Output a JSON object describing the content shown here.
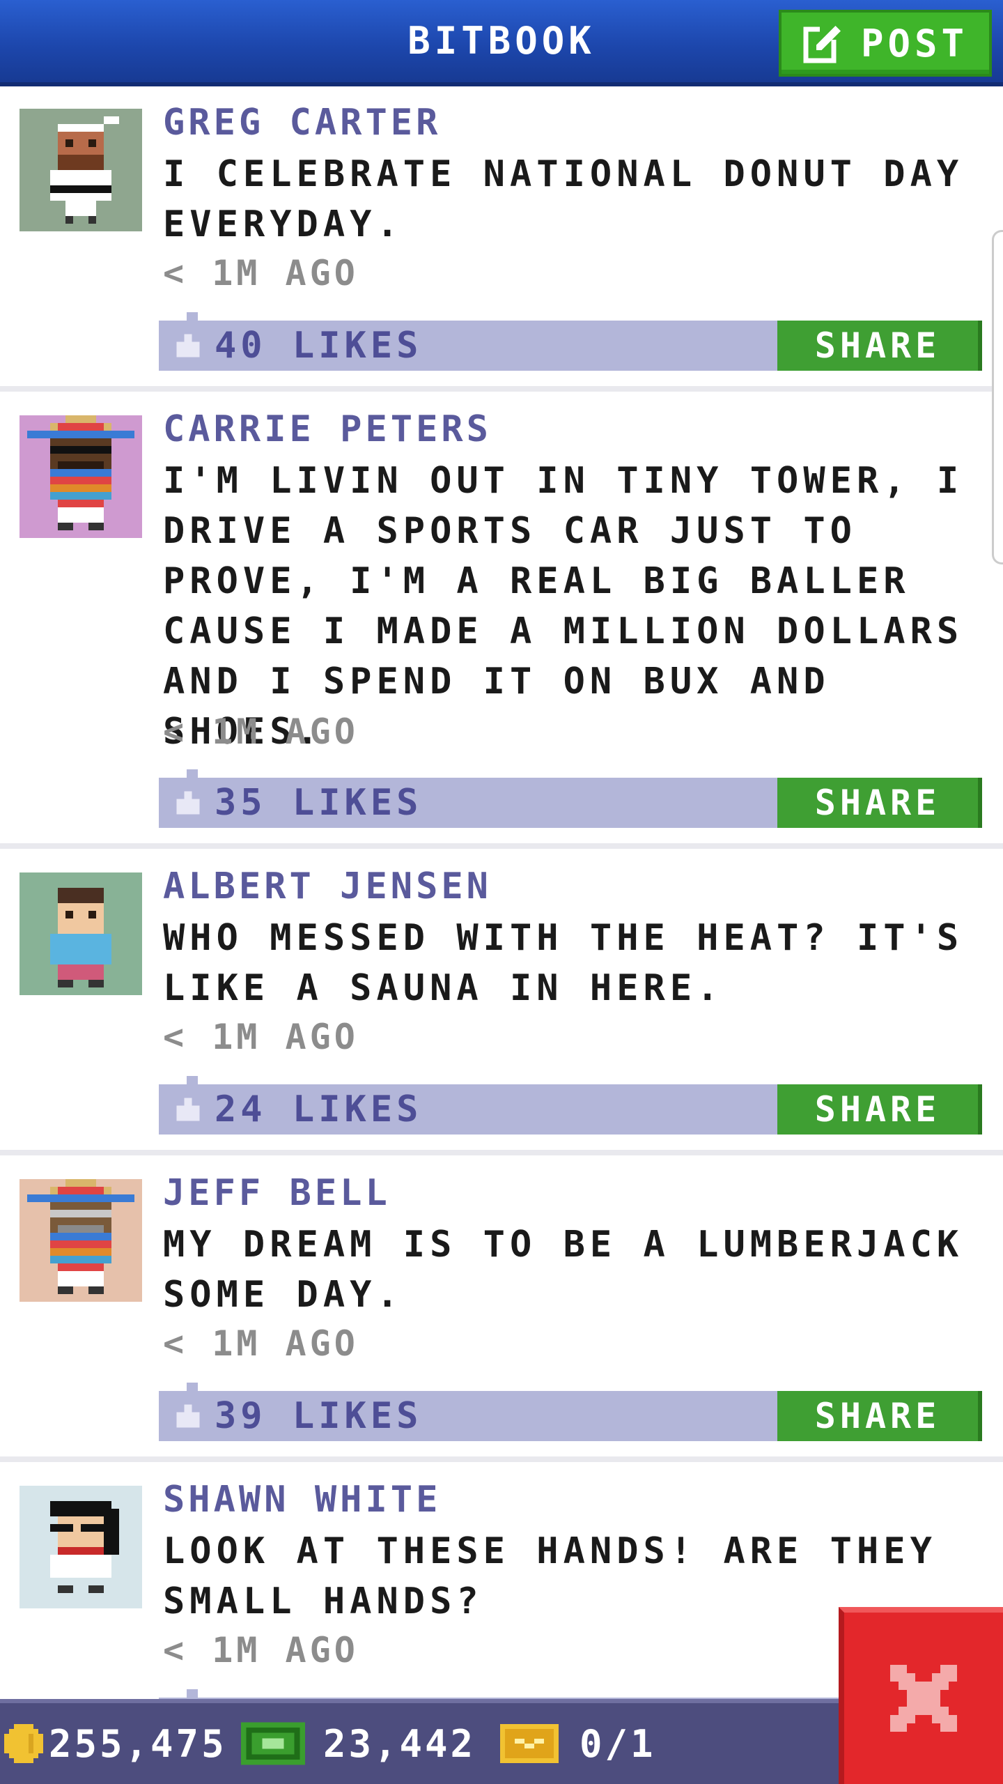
{
  "header": {
    "title": "BITBOOK",
    "post_label": "POST"
  },
  "posts": [
    {
      "name": "GREG CARTER",
      "text": "I CELEBRATE NATIONAL DONUT DAY EVERYDAY.",
      "time": "< 1M AGO",
      "likes": "40 LIKES",
      "share": "SHARE",
      "avatar_bg": "#8fa68f"
    },
    {
      "name": "CARRIE PETERS",
      "text": "I'M LIVIN OUT IN TINY TOWER, I DRIVE A SPORTS CAR JUST TO PROVE, I'M A REAL BIG BALLER CAUSE I MADE A MILLION DOLLARS AND I SPEND IT ON BUX AND SHOES.",
      "time": "< 1M AGO",
      "likes": "35 LIKES",
      "share": "SHARE",
      "avatar_bg": "#cf9ad0"
    },
    {
      "name": "ALBERT JENSEN",
      "text": "WHO MESSED WITH THE HEAT? IT'S LIKE A SAUNA IN HERE.",
      "time": "< 1M AGO",
      "likes": "24 LIKES",
      "share": "SHARE",
      "avatar_bg": "#88b296"
    },
    {
      "name": "JEFF BELL",
      "text": "MY DREAM IS TO BE A LUMBERJACK SOME DAY.",
      "time": "< 1M AGO",
      "likes": "39 LIKES",
      "share": "SHARE",
      "avatar_bg": "#e6c1ab"
    },
    {
      "name": "SHAWN WHITE",
      "text": "LOOK AT THESE HANDS! ARE THEY SMALL HANDS?",
      "time": "< 1M AGO",
      "likes": "",
      "share": "",
      "avatar_bg": "#d6e5ea"
    }
  ],
  "footer": {
    "coins": "255,475",
    "bux": "23,442",
    "tickets": "0/1"
  },
  "colors": {
    "header_blue": "#1d47ad",
    "post_green": "#3fb52a",
    "share_green": "#3f9f33",
    "like_bar": "#b3b6d9",
    "name_purple": "#5a5a9c",
    "close_red": "#e3272b"
  },
  "icons": {
    "post": "edit-icon",
    "like": "thumbs-up-icon",
    "coins": "coin-icon",
    "bux": "bux-icon",
    "tickets": "ticket-icon",
    "close": "close-icon"
  }
}
